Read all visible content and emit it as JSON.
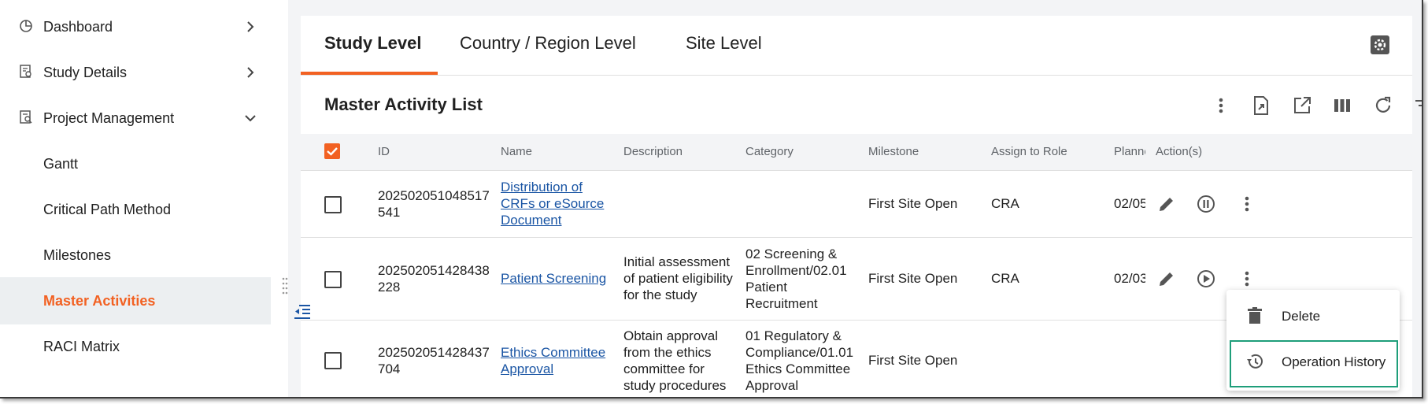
{
  "sidebar": {
    "items": [
      {
        "label": "Dashboard",
        "icon": "pie-chart-icon",
        "expanded": false
      },
      {
        "label": "Study Details",
        "icon": "document-search-icon",
        "expanded": false
      },
      {
        "label": "Project Management",
        "icon": "document-search-icon",
        "expanded": true
      }
    ],
    "subitems": [
      {
        "label": "Gantt"
      },
      {
        "label": "Critical Path Method"
      },
      {
        "label": "Milestones"
      },
      {
        "label": "Master Activities",
        "active": true
      },
      {
        "label": "RACI Matrix"
      }
    ]
  },
  "tabs": [
    {
      "label": "Study Level",
      "active": true
    },
    {
      "label": "Country / Region Level"
    },
    {
      "label": "Site Level"
    }
  ],
  "list": {
    "title": "Master Activity List"
  },
  "table": {
    "headers": [
      "ID",
      "Name",
      "Description",
      "Category",
      "Milestone",
      "Assign to Role",
      "Planne",
      "Action(s)"
    ],
    "rows": [
      {
        "id": [
          "202502051048517",
          "541"
        ],
        "name": [
          "Distribution of",
          "CRFs or eSource",
          "Document"
        ],
        "description": [],
        "category": [],
        "milestone": "First Site Open",
        "role": "CRA",
        "planned": "02/05"
      },
      {
        "id": [
          "202502051428438",
          "228"
        ],
        "name": [
          "Patient Screening"
        ],
        "description": [
          "Initial assessment",
          "of patient eligibility",
          "for the study"
        ],
        "category": [
          "02 Screening &",
          "Enrollment/02.01",
          "Patient",
          "Recruitment"
        ],
        "milestone": "First Site Open",
        "role": "CRA",
        "planned": "02/03"
      },
      {
        "id": [
          "202502051428437",
          "704"
        ],
        "name": [
          "Ethics Committee",
          "Approval"
        ],
        "description": [
          "Obtain approval",
          "from the ethics",
          "committee for",
          "study procedures"
        ],
        "category": [
          "01 Regulatory &",
          "Compliance/01.01",
          "Ethics Committee",
          "Approval"
        ],
        "milestone": "First Site Open",
        "role": "",
        "planned": ""
      }
    ]
  },
  "context_menu": {
    "items": [
      {
        "label": "Delete",
        "icon": "trash-icon"
      },
      {
        "label": "Operation History",
        "icon": "history-icon"
      }
    ]
  },
  "colors": {
    "accent": "#f26122",
    "link": "#1a55a4",
    "highlight_border": "#1e9e7a"
  }
}
